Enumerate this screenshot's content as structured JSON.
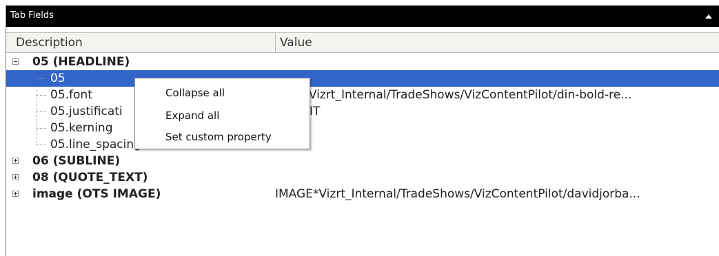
{
  "panel": {
    "title": "Tab Fields"
  },
  "columns": {
    "description": "Description",
    "value": "Value"
  },
  "rows": [
    {
      "label": "05 (HEADLINE)",
      "value": ""
    },
    {
      "label": "05",
      "value": ""
    },
    {
      "label": "05.font",
      "value": "T*Vizrt_Internal/TradeShows/VizContentPilot/din-bold-re..."
    },
    {
      "label": "05.justificati",
      "value": "IT"
    },
    {
      "label": "05.kerning",
      "value": ""
    },
    {
      "label": "05.line_spacing",
      "value": "0"
    },
    {
      "label": "06 (SUBLINE)",
      "value": ""
    },
    {
      "label": "08 (QUOTE_TEXT)",
      "value": ""
    },
    {
      "label": "image (OTS IMAGE)",
      "value": "IMAGE*Vizrt_Internal/TradeShows/VizContentPilot/davidjorba..."
    }
  ],
  "context_menu": {
    "items": [
      "Collapse all",
      "Expand all",
      "Set custom property"
    ]
  },
  "colors": {
    "selection": "#3365c8",
    "titlebar": "#000000"
  }
}
